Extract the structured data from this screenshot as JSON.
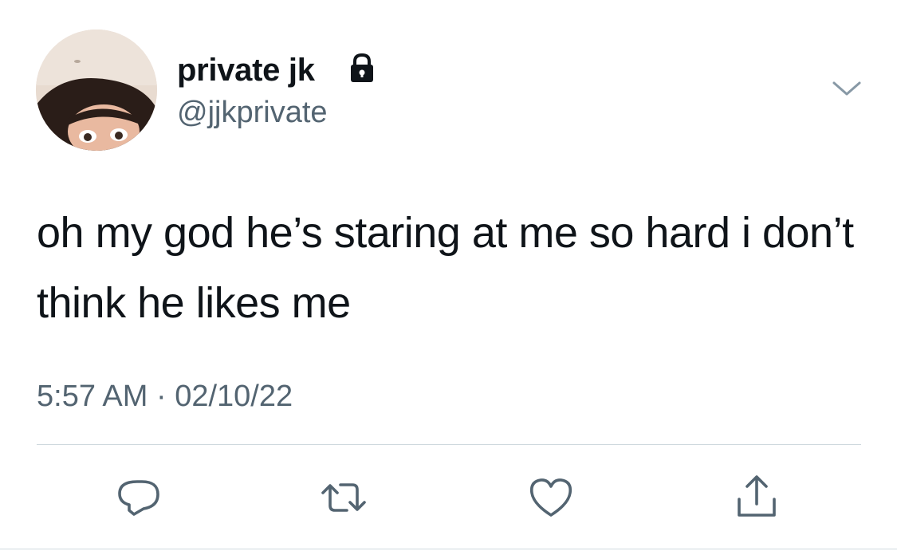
{
  "tweet": {
    "display_name": "private jk",
    "handle": "@jjkprivate",
    "text": "oh my god he’s staring at me so hard i don’t think he likes me",
    "time": "5:57 AM",
    "separator": "·",
    "date": "02/10/22"
  },
  "icons": {
    "lock": "lock-icon",
    "more": "chevron-down-icon",
    "reply": "reply-icon",
    "retweet": "retweet-icon",
    "like": "heart-icon",
    "share": "share-icon"
  },
  "colors": {
    "text": "#0f1419",
    "secondary": "#536471",
    "divider": "#cfd9de",
    "background": "#ffffff"
  }
}
